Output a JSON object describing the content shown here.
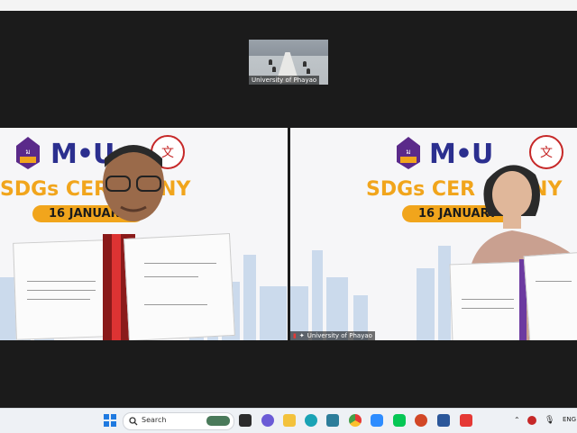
{
  "thumbnail": {
    "name": "University of Phayao"
  },
  "left_tile": {
    "mou": "M•U",
    "sdgs": "SDGs CER",
    "sdgs_tail": "NY",
    "date": "16 JANUARY"
  },
  "right_tile": {
    "mou": "M•U",
    "sdgs": "SDGs CER",
    "sdgs_tail": "NY",
    "date": "16 JANUARY",
    "name": "University of Phayao"
  },
  "taskbar": {
    "search_label": "Search",
    "lang": "ENG"
  },
  "colors": {
    "accent_orange": "#f1a51c",
    "mou_blue": "#2b2f8f",
    "mou_red": "#e11d2a"
  }
}
